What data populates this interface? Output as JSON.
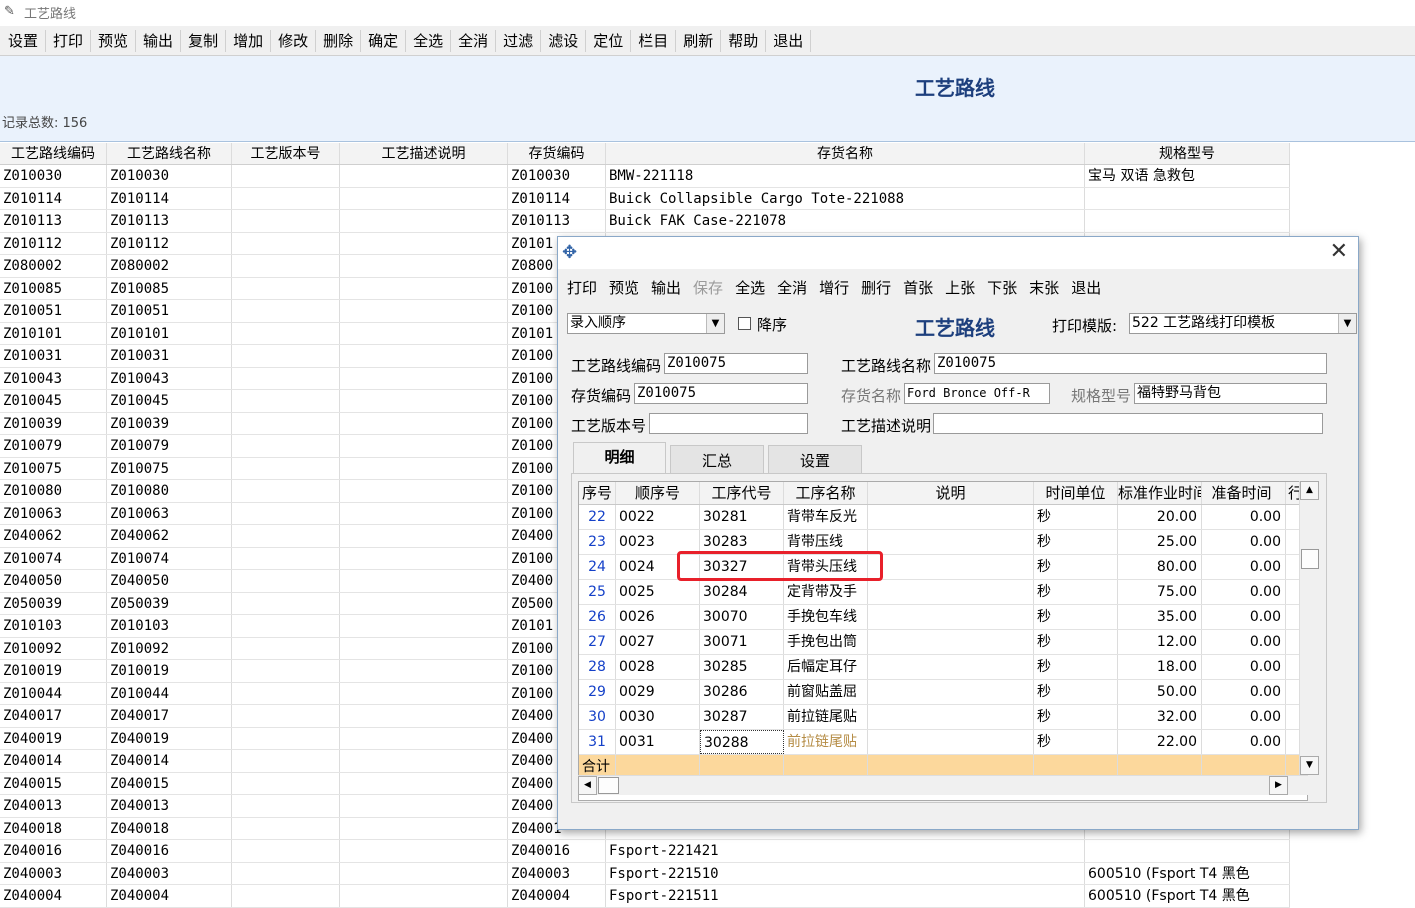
{
  "window": {
    "title": "工艺路线"
  },
  "toolbar": [
    "设置",
    "打印",
    "预览",
    "输出",
    "复制",
    "增加",
    "修改",
    "删除",
    "确定",
    "全选",
    "全消",
    "过滤",
    "滤设",
    "定位",
    "栏目",
    "刷新",
    "帮助",
    "退出"
  ],
  "page": {
    "title": "工艺路线",
    "record_count": "记录总数: 156"
  },
  "grid": {
    "columns": [
      "工艺路线编码",
      "工艺路线名称",
      "工艺版本号",
      "工艺描述说明",
      "存货编码",
      "存货名称",
      "规格型号"
    ],
    "rows": [
      [
        "Z010030",
        "Z010030",
        "",
        "",
        "Z010030",
        "BMW-221118",
        "宝马 双语 急救包"
      ],
      [
        "Z010114",
        "Z010114",
        "",
        "",
        "Z010114",
        "Buick  Collapsible  Cargo  Tote-221088",
        ""
      ],
      [
        "Z010113",
        "Z010113",
        "",
        "",
        "Z010113",
        "Buick  FAK  Case-221078",
        ""
      ],
      [
        "Z010112",
        "Z010112",
        "",
        "",
        "Z0101",
        "",
        ""
      ],
      [
        "Z080002",
        "Z080002",
        "",
        "",
        "Z0800",
        "",
        ""
      ],
      [
        "Z010085",
        "Z010085",
        "",
        "",
        "Z0100",
        "",
        ""
      ],
      [
        "Z010051",
        "Z010051",
        "",
        "",
        "Z0100",
        "",
        ""
      ],
      [
        "Z010101",
        "Z010101",
        "",
        "",
        "Z0101",
        "",
        ""
      ],
      [
        "Z010031",
        "Z010031",
        "",
        "",
        "Z0100",
        "",
        ""
      ],
      [
        "Z010043",
        "Z010043",
        "",
        "",
        "Z0100",
        "",
        ""
      ],
      [
        "Z010045",
        "Z010045",
        "",
        "",
        "Z0100",
        "",
        ""
      ],
      [
        "Z010039",
        "Z010039",
        "",
        "",
        "Z0100",
        "",
        ""
      ],
      [
        "Z010079",
        "Z010079",
        "",
        "",
        "Z0100",
        "",
        ""
      ],
      [
        "Z010075",
        "Z010075",
        "",
        "",
        "Z0100",
        "",
        ""
      ],
      [
        "Z010080",
        "Z010080",
        "",
        "",
        "Z0100",
        "",
        ""
      ],
      [
        "Z010063",
        "Z010063",
        "",
        "",
        "Z0100",
        "",
        ""
      ],
      [
        "Z040062",
        "Z040062",
        "",
        "",
        "Z0400",
        "",
        ""
      ],
      [
        "Z010074",
        "Z010074",
        "",
        "",
        "Z0100",
        "",
        ""
      ],
      [
        "Z040050",
        "Z040050",
        "",
        "",
        "Z0400",
        "",
        ""
      ],
      [
        "Z050039",
        "Z050039",
        "",
        "",
        "Z0500",
        "",
        ""
      ],
      [
        "Z010103",
        "Z010103",
        "",
        "",
        "Z0101",
        "",
        ""
      ],
      [
        "Z010092",
        "Z010092",
        "",
        "",
        "Z0100",
        "",
        ""
      ],
      [
        "Z010019",
        "Z010019",
        "",
        "",
        "Z0100",
        "",
        ""
      ],
      [
        "Z010044",
        "Z010044",
        "",
        "",
        "Z0100",
        "",
        ""
      ],
      [
        "Z040017",
        "Z040017",
        "",
        "",
        "Z0400",
        "",
        ""
      ],
      [
        "Z040019",
        "Z040019",
        "",
        "",
        "Z0400",
        "",
        ""
      ],
      [
        "Z040014",
        "Z040014",
        "",
        "",
        "Z0400",
        "",
        ""
      ],
      [
        "Z040015",
        "Z040015",
        "",
        "",
        "Z0400",
        "",
        ""
      ],
      [
        "Z040013",
        "Z040013",
        "",
        "",
        "Z0400",
        "",
        ""
      ],
      [
        "Z040018",
        "Z040018",
        "",
        "",
        "Z04001",
        "",
        ""
      ],
      [
        "Z040016",
        "Z040016",
        "",
        "",
        "Z040016",
        "Fsport-221421",
        ""
      ],
      [
        "Z040003",
        "Z040003",
        "",
        "",
        "Z040003",
        "Fsport-221510",
        "600510  (Fsport  T4  黑色"
      ],
      [
        "Z040004",
        "Z040004",
        "",
        "",
        "Z040004",
        "Fsport-221511",
        "600510  (Fsport  T4  黑色"
      ]
    ]
  },
  "dialog": {
    "toolbar": [
      {
        "label": "打印",
        "enabled": true
      },
      {
        "label": "预览",
        "enabled": true
      },
      {
        "label": "输出",
        "enabled": true
      },
      {
        "label": "保存",
        "enabled": false
      },
      {
        "label": "全选",
        "enabled": true
      },
      {
        "label": "全消",
        "enabled": true
      },
      {
        "label": "增行",
        "enabled": true
      },
      {
        "label": "删行",
        "enabled": true
      },
      {
        "label": "首张",
        "enabled": true
      },
      {
        "label": "上张",
        "enabled": true
      },
      {
        "label": "下张",
        "enabled": true
      },
      {
        "label": "末张",
        "enabled": true
      },
      {
        "label": "退出",
        "enabled": true
      }
    ],
    "sort_select": "录入顺序",
    "desc_label": "降序",
    "title": "工艺路线",
    "print_template_label": "打印模版:",
    "print_template_value": "522 工艺路线打印模板",
    "fields": {
      "route_code_label": "工艺路线编码",
      "route_code": "Z010075",
      "route_name_label": "工艺路线名称",
      "route_name": "Z010075",
      "inv_code_label": "存货编码",
      "inv_code": "Z010075",
      "inv_name_label": "存货名称",
      "inv_name": "Ford  Bronce  Off-R",
      "spec_label": "规格型号",
      "spec": "福特野马背包",
      "version_label": "工艺版本号",
      "version": "",
      "desc_label": "工艺描述说明",
      "desc": ""
    },
    "tabs": [
      "明细",
      "汇总",
      "设置"
    ],
    "detail": {
      "columns": [
        "序号",
        "顺序号",
        "工序代号",
        "工序名称",
        "说明",
        "时间单位",
        "标准作业时间",
        "准备时间",
        "行"
      ],
      "rows": [
        [
          "22",
          "0022",
          "30281",
          "背带车反光",
          "",
          "秒",
          "20.00",
          "0.00"
        ],
        [
          "23",
          "0023",
          "30283",
          "背带压线",
          "",
          "秒",
          "25.00",
          "0.00"
        ],
        [
          "24",
          "0024",
          "30327",
          "背带头压线",
          "",
          "秒",
          "80.00",
          "0.00"
        ],
        [
          "25",
          "0025",
          "30284",
          "定背带及手",
          "",
          "秒",
          "75.00",
          "0.00"
        ],
        [
          "26",
          "0026",
          "30070",
          "手挽包车线",
          "",
          "秒",
          "35.00",
          "0.00"
        ],
        [
          "27",
          "0027",
          "30071",
          "手挽包出筒",
          "",
          "秒",
          "12.00",
          "0.00"
        ],
        [
          "28",
          "0028",
          "30285",
          "后幅定耳仔",
          "",
          "秒",
          "18.00",
          "0.00"
        ],
        [
          "29",
          "0029",
          "30286",
          "前窗贴盖屈",
          "",
          "秒",
          "50.00",
          "0.00"
        ],
        [
          "30",
          "0030",
          "30287",
          "前拉链尾贴",
          "",
          "秒",
          "32.00",
          "0.00"
        ],
        [
          "31",
          "0031",
          "30288",
          "前拉链尾贴",
          "",
          "秒",
          "22.00",
          "0.00"
        ]
      ],
      "sum_label": "合计"
    }
  },
  "colors": {
    "accent_title": "#1d3f7d",
    "highlight_box": "#e8202a",
    "sum_row": "#fcd89c"
  }
}
